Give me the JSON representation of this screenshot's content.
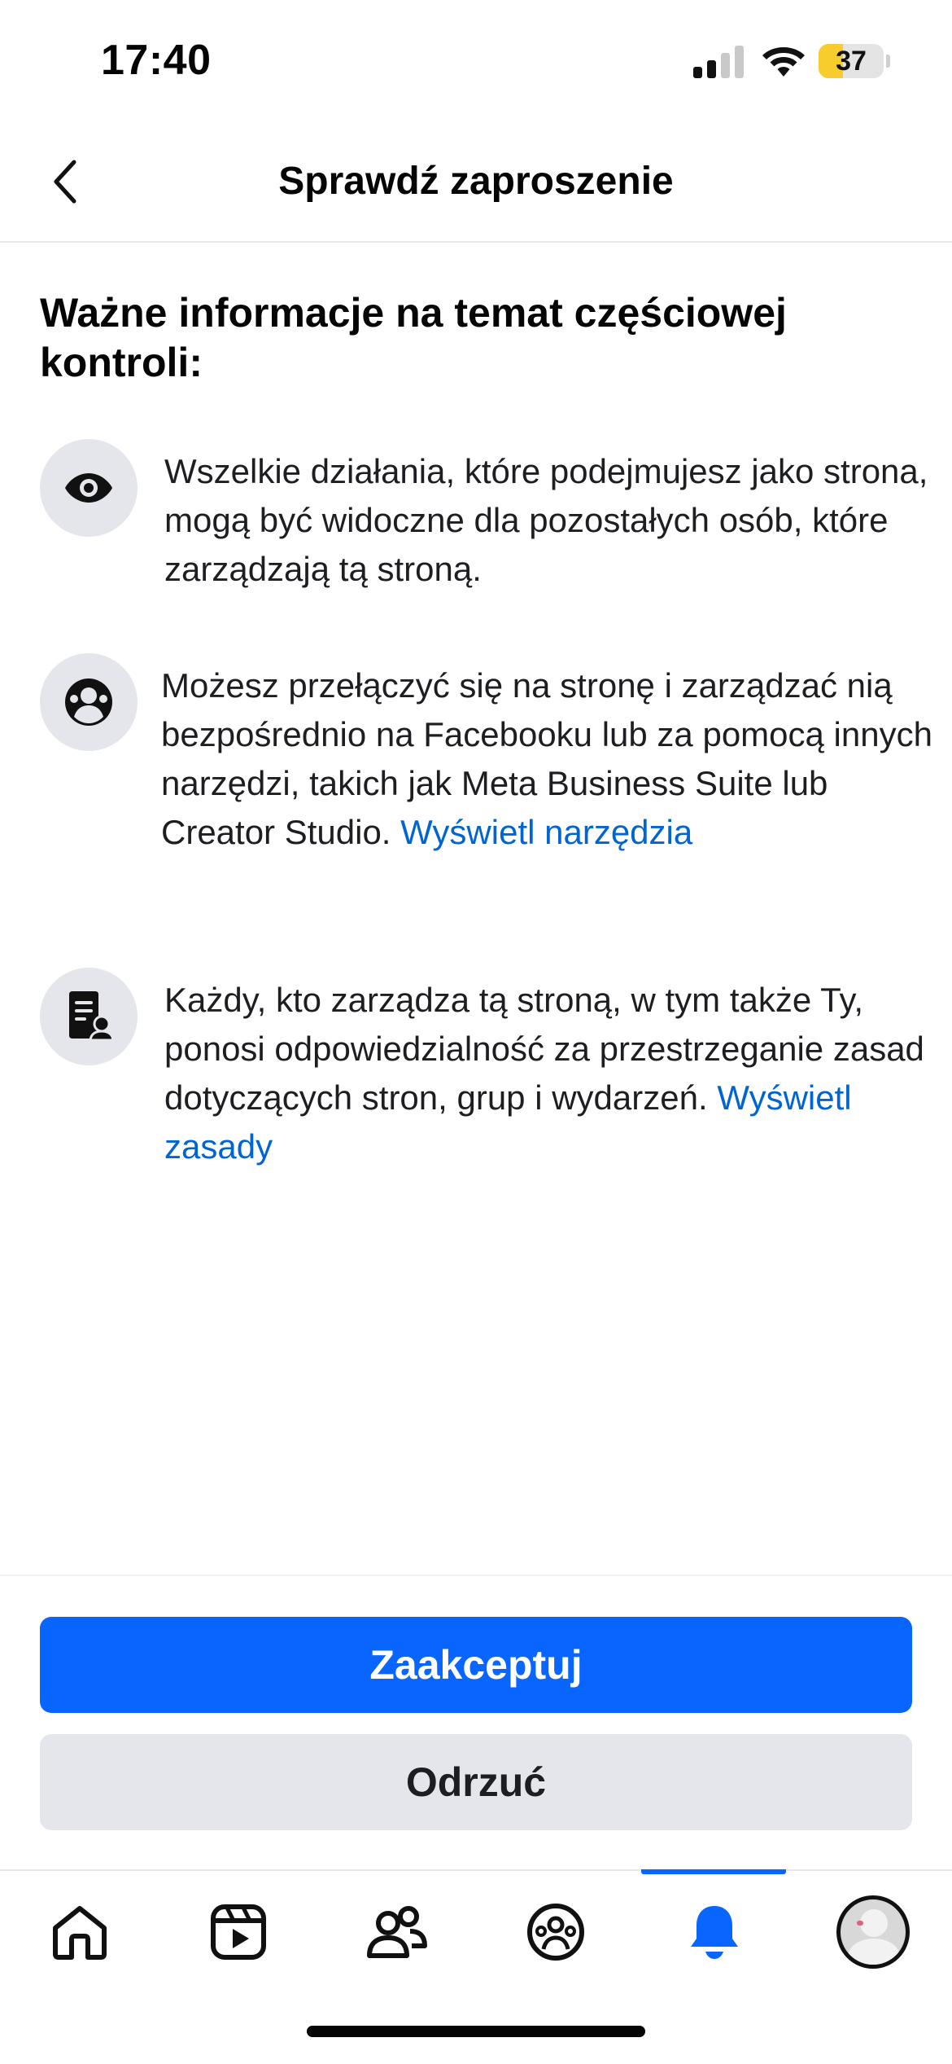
{
  "status_bar": {
    "time": "17:40",
    "battery_level": 37,
    "battery_text": "37",
    "battery_color": "#f7cd2e",
    "signal_bars_active": 2,
    "signal_bars_total": 4,
    "icons": [
      "signal-icon",
      "wifi-icon",
      "battery-icon"
    ]
  },
  "header": {
    "title": "Sprawdź zaproszenie",
    "back_icon": "chevron-left-icon"
  },
  "main": {
    "heading": "Ważne informacje na temat częściowej kontroli:",
    "items": [
      {
        "icon": "eye-icon",
        "text": "Wszelkie działania, które podejmujesz jako strona, mogą być widoczne dla pozostałych osób, które zarządzają tą stroną.",
        "link": ""
      },
      {
        "icon": "people-circle-icon",
        "text": "Możesz przełączyć się na stronę i zarządzać nią bezpośrednio na Facebooku lub za pomocą innych narzędzi, takich jak Meta Business Suite lub Creator Studio.",
        "link": "Wyświetl narzędzia"
      },
      {
        "icon": "document-person-icon",
        "text": "Każdy, kto zarządza tą stroną, w tym także Ty, ponosi odpowiedzialność za przestrzeganie zasad dotyczących stron, grup i wydarzeń.",
        "link": "Wyświetl zasady"
      }
    ]
  },
  "actions": {
    "accept_label": "Zaakceptuj",
    "reject_label": "Odrzuć"
  },
  "bottom_nav": {
    "active_tab": "notifications",
    "items": [
      {
        "id": "home",
        "icon": "home-icon"
      },
      {
        "id": "video",
        "icon": "video-icon"
      },
      {
        "id": "friends",
        "icon": "friends-icon"
      },
      {
        "id": "groups",
        "icon": "groups-icon"
      },
      {
        "id": "notifications",
        "icon": "bell-icon"
      },
      {
        "id": "profile",
        "icon": "avatar"
      }
    ]
  },
  "colors": {
    "accent": "#0866ff",
    "link": "#0064d1",
    "secondary_button": "#e4e6eb",
    "icon_background": "#e4e6eb"
  }
}
